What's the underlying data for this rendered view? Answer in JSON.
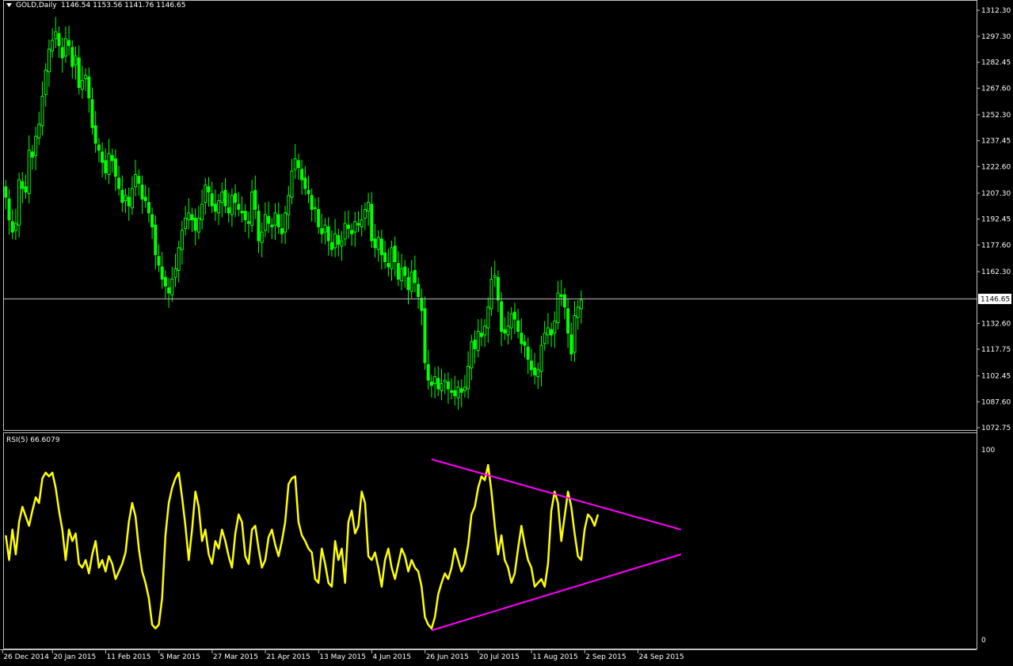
{
  "main": {
    "header_arrow": "triangle-down-icon",
    "symbol": "GOLD,Daily",
    "ohlc": "1146.54 1153.56 1141.76 1146.65",
    "current_price": "1146.65",
    "price_ticks": [
      "1312.30",
      "1297.30",
      "1282.45",
      "1267.60",
      "1252.30",
      "1237.45",
      "1222.60",
      "1207.30",
      "1192.45",
      "1177.60",
      "1162.30",
      "1132.60",
      "1117.75",
      "1102.45",
      "1087.60",
      "1072.75"
    ],
    "price_tick_values": [
      1312.3,
      1297.3,
      1282.45,
      1267.6,
      1252.3,
      1237.45,
      1222.6,
      1207.3,
      1192.45,
      1177.6,
      1162.3,
      1132.6,
      1117.75,
      1102.45,
      1087.6,
      1072.75
    ]
  },
  "rsi": {
    "label": "RSI(5) 66.6079",
    "ticks": [
      "100",
      "0"
    ],
    "tick_values": [
      100,
      0
    ]
  },
  "time_axis": {
    "labels": [
      "26 Dec 2014",
      "20 Jan 2015",
      "11 Feb 2015",
      "5 Mar 2015",
      "27 Mar 2015",
      "21 Apr 2015",
      "13 May 2015",
      "4 Jun 2015",
      "26 Jun 2015",
      "20 Jul 2015",
      "11 Aug 2015",
      "2 Sep 2015",
      "24 Sep 2015"
    ],
    "label_bar_index": [
      0,
      15,
      31,
      47,
      63,
      79,
      95,
      111,
      127,
      143,
      159,
      175,
      191
    ]
  },
  "colors": {
    "background": "#000000",
    "candle": "#00ff00",
    "rsi_line": "#ffff00",
    "trendline": "#ff00ff",
    "grid_line": "#c0c0c0",
    "text": "#ffffff"
  },
  "chart_data": [
    {
      "type": "candlestick",
      "title": "GOLD,Daily",
      "ylim": [
        1072.75,
        1312.3
      ],
      "current_price": 1146.65,
      "closes": [
        1205,
        1192,
        1185,
        1190,
        1215,
        1210,
        1208,
        1232,
        1228,
        1240,
        1247,
        1263,
        1278,
        1290,
        1295,
        1300,
        1292,
        1285,
        1296,
        1292,
        1280,
        1286,
        1268,
        1272,
        1275,
        1262,
        1245,
        1236,
        1232,
        1225,
        1219,
        1230,
        1226,
        1217,
        1210,
        1202,
        1206,
        1200,
        1210,
        1218,
        1213,
        1204,
        1203,
        1196,
        1188,
        1172,
        1166,
        1158,
        1154,
        1150,
        1158,
        1164,
        1176,
        1186,
        1193,
        1196,
        1192,
        1186,
        1193,
        1201,
        1212,
        1208,
        1200,
        1197,
        1203,
        1208,
        1200,
        1196,
        1206,
        1202,
        1198,
        1196,
        1192,
        1190,
        1208,
        1198,
        1180,
        1185,
        1195,
        1190,
        1188,
        1196,
        1188,
        1184,
        1196,
        1206,
        1220,
        1227,
        1222,
        1215,
        1210,
        1207,
        1198,
        1199,
        1188,
        1184,
        1189,
        1180,
        1175,
        1184,
        1178,
        1180,
        1190,
        1187,
        1184,
        1191,
        1189,
        1192,
        1198,
        1202,
        1180,
        1176,
        1182,
        1172,
        1168,
        1165,
        1176,
        1168,
        1158,
        1164,
        1160,
        1152,
        1162,
        1156,
        1148,
        1140,
        1110,
        1100,
        1097,
        1102,
        1095,
        1098,
        1100,
        1095,
        1093,
        1091,
        1096,
        1093,
        1096,
        1108,
        1122,
        1118,
        1128,
        1125,
        1131,
        1142,
        1158,
        1160,
        1146,
        1128,
        1127,
        1131,
        1138,
        1135,
        1128,
        1121,
        1120,
        1112,
        1106,
        1103,
        1106,
        1120,
        1127,
        1130,
        1126,
        1134,
        1150,
        1148,
        1142,
        1127,
        1115,
        1137,
        1142,
        1146
      ],
      "highs_max": 1307,
      "lows_min": 1077
    },
    {
      "type": "line",
      "title": "RSI(5) 66.6079",
      "ylim": [
        0,
        100
      ],
      "values": [
        55,
        42,
        58,
        45,
        62,
        70,
        65,
        60,
        68,
        75,
        72,
        85,
        88,
        86,
        88,
        80,
        68,
        58,
        42,
        58,
        52,
        56,
        40,
        38,
        42,
        35,
        45,
        52,
        38,
        42,
        36,
        44,
        40,
        32,
        36,
        40,
        46,
        62,
        72,
        65,
        48,
        36,
        30,
        22,
        8,
        6,
        8,
        22,
        55,
        72,
        80,
        85,
        88,
        75,
        60,
        42,
        58,
        78,
        70,
        52,
        58,
        45,
        40,
        52,
        48,
        58,
        52,
        44,
        38,
        56,
        66,
        62,
        44,
        40,
        58,
        60,
        48,
        38,
        42,
        54,
        58,
        50,
        44,
        52,
        62,
        82,
        85,
        86,
        62,
        55,
        52,
        48,
        46,
        32,
        30,
        48,
        40,
        30,
        28,
        52,
        42,
        48,
        30,
        62,
        68,
        56,
        60,
        78,
        72,
        44,
        42,
        46,
        38,
        28,
        42,
        48,
        38,
        32,
        40,
        48,
        44,
        36,
        42,
        38,
        36,
        28,
        12,
        8,
        6,
        12,
        24,
        30,
        35,
        32,
        38,
        48,
        42,
        36,
        40,
        50,
        66,
        70,
        80,
        86,
        84,
        92,
        78,
        60,
        45,
        55,
        42,
        38,
        30,
        35,
        48,
        60,
        50,
        42,
        38,
        28,
        30,
        32,
        28,
        40,
        68,
        78,
        72,
        52,
        65,
        78,
        70,
        56,
        44,
        42,
        58,
        66,
        64,
        60,
        66
      ]
    }
  ],
  "trendlines": [
    {
      "name": "upper",
      "from": [
        128,
        95
      ],
      "to": [
        203,
        58
      ]
    },
    {
      "name": "lower",
      "from": [
        128,
        5
      ],
      "to": [
        203,
        45
      ]
    }
  ]
}
